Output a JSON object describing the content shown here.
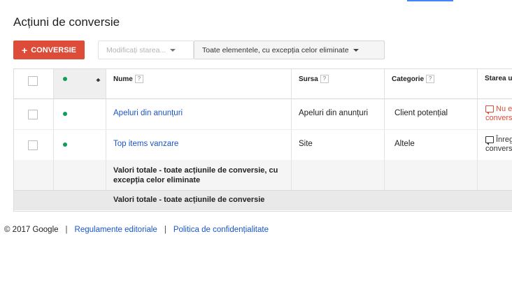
{
  "page": {
    "title": "Acțiuni de conversie"
  },
  "toolbar": {
    "add_label": "CONVERSIE",
    "status_label": "Modificați starea...",
    "filter_label": "Toate elementele, cu excepția celor eliminate"
  },
  "table": {
    "headers": {
      "name": "Nume",
      "source": "Sursa",
      "category": "Categorie",
      "state": "Starea u",
      "help": "?"
    },
    "rows": [
      {
        "name": "Apeluri din anunțuri",
        "source": "Apeluri din anunțuri",
        "category": "Client potențial",
        "state_line1": "Nu e",
        "state_line2": "convers",
        "state_color": "#dd4b39"
      },
      {
        "name": "Top items vanzare",
        "source": "Site",
        "category": "Altele",
        "state_line1": "Înreg",
        "state_line2": "conversi",
        "state_color": "#333333"
      }
    ],
    "totals": [
      "Valori totale - toate acțiunile de conversie, cu excepția celor eliminate",
      "Valori totale - toate acțiunile de conversie"
    ]
  },
  "footer": {
    "copyright": "© 2017 Google",
    "separator": "|",
    "link1": "Regulamente editoriale",
    "link2": "Politica de confidențialitate"
  },
  "colors": {
    "accent_red": "#dd4b39",
    "link_blue": "#1a55c7",
    "status_green": "#0f9d58"
  }
}
